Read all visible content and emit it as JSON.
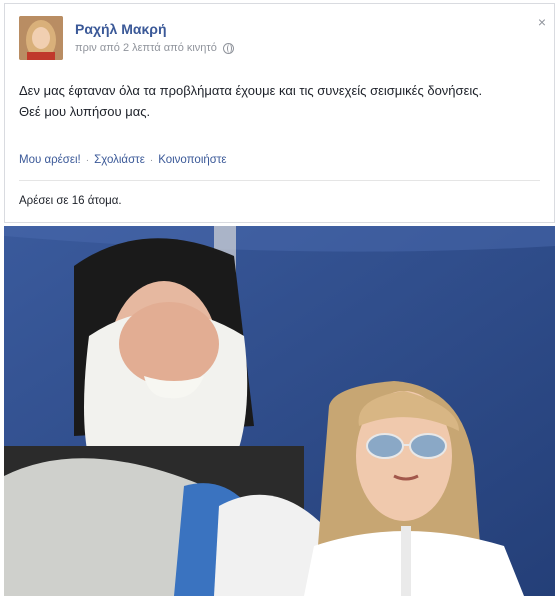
{
  "post": {
    "author": "Ραχήλ Μακρή",
    "meta": "πριν από 2 λεπτά από κινητό",
    "text_line1": "Δεν μας έφταναν όλα τα προβλήματα έχουμε και τις συνεχείς σεισμικές δονήσεις.",
    "text_line2": "Θεέ μου λυπήσου μας.",
    "close_label": "×",
    "icons": {
      "privacy": "globe-icon",
      "close": "close-icon"
    }
  },
  "actions": {
    "like": "Μου αρέσει!",
    "comment": "Σχολιάστε",
    "share": "Κοινοποιήστε",
    "separator": "·"
  },
  "likes": {
    "text": "Αρέσει σε 16 άτομα."
  },
  "colors": {
    "link": "#3b5998",
    "meta": "#90949c",
    "text": "#1d2129",
    "tarp": "#2f4d8a"
  }
}
